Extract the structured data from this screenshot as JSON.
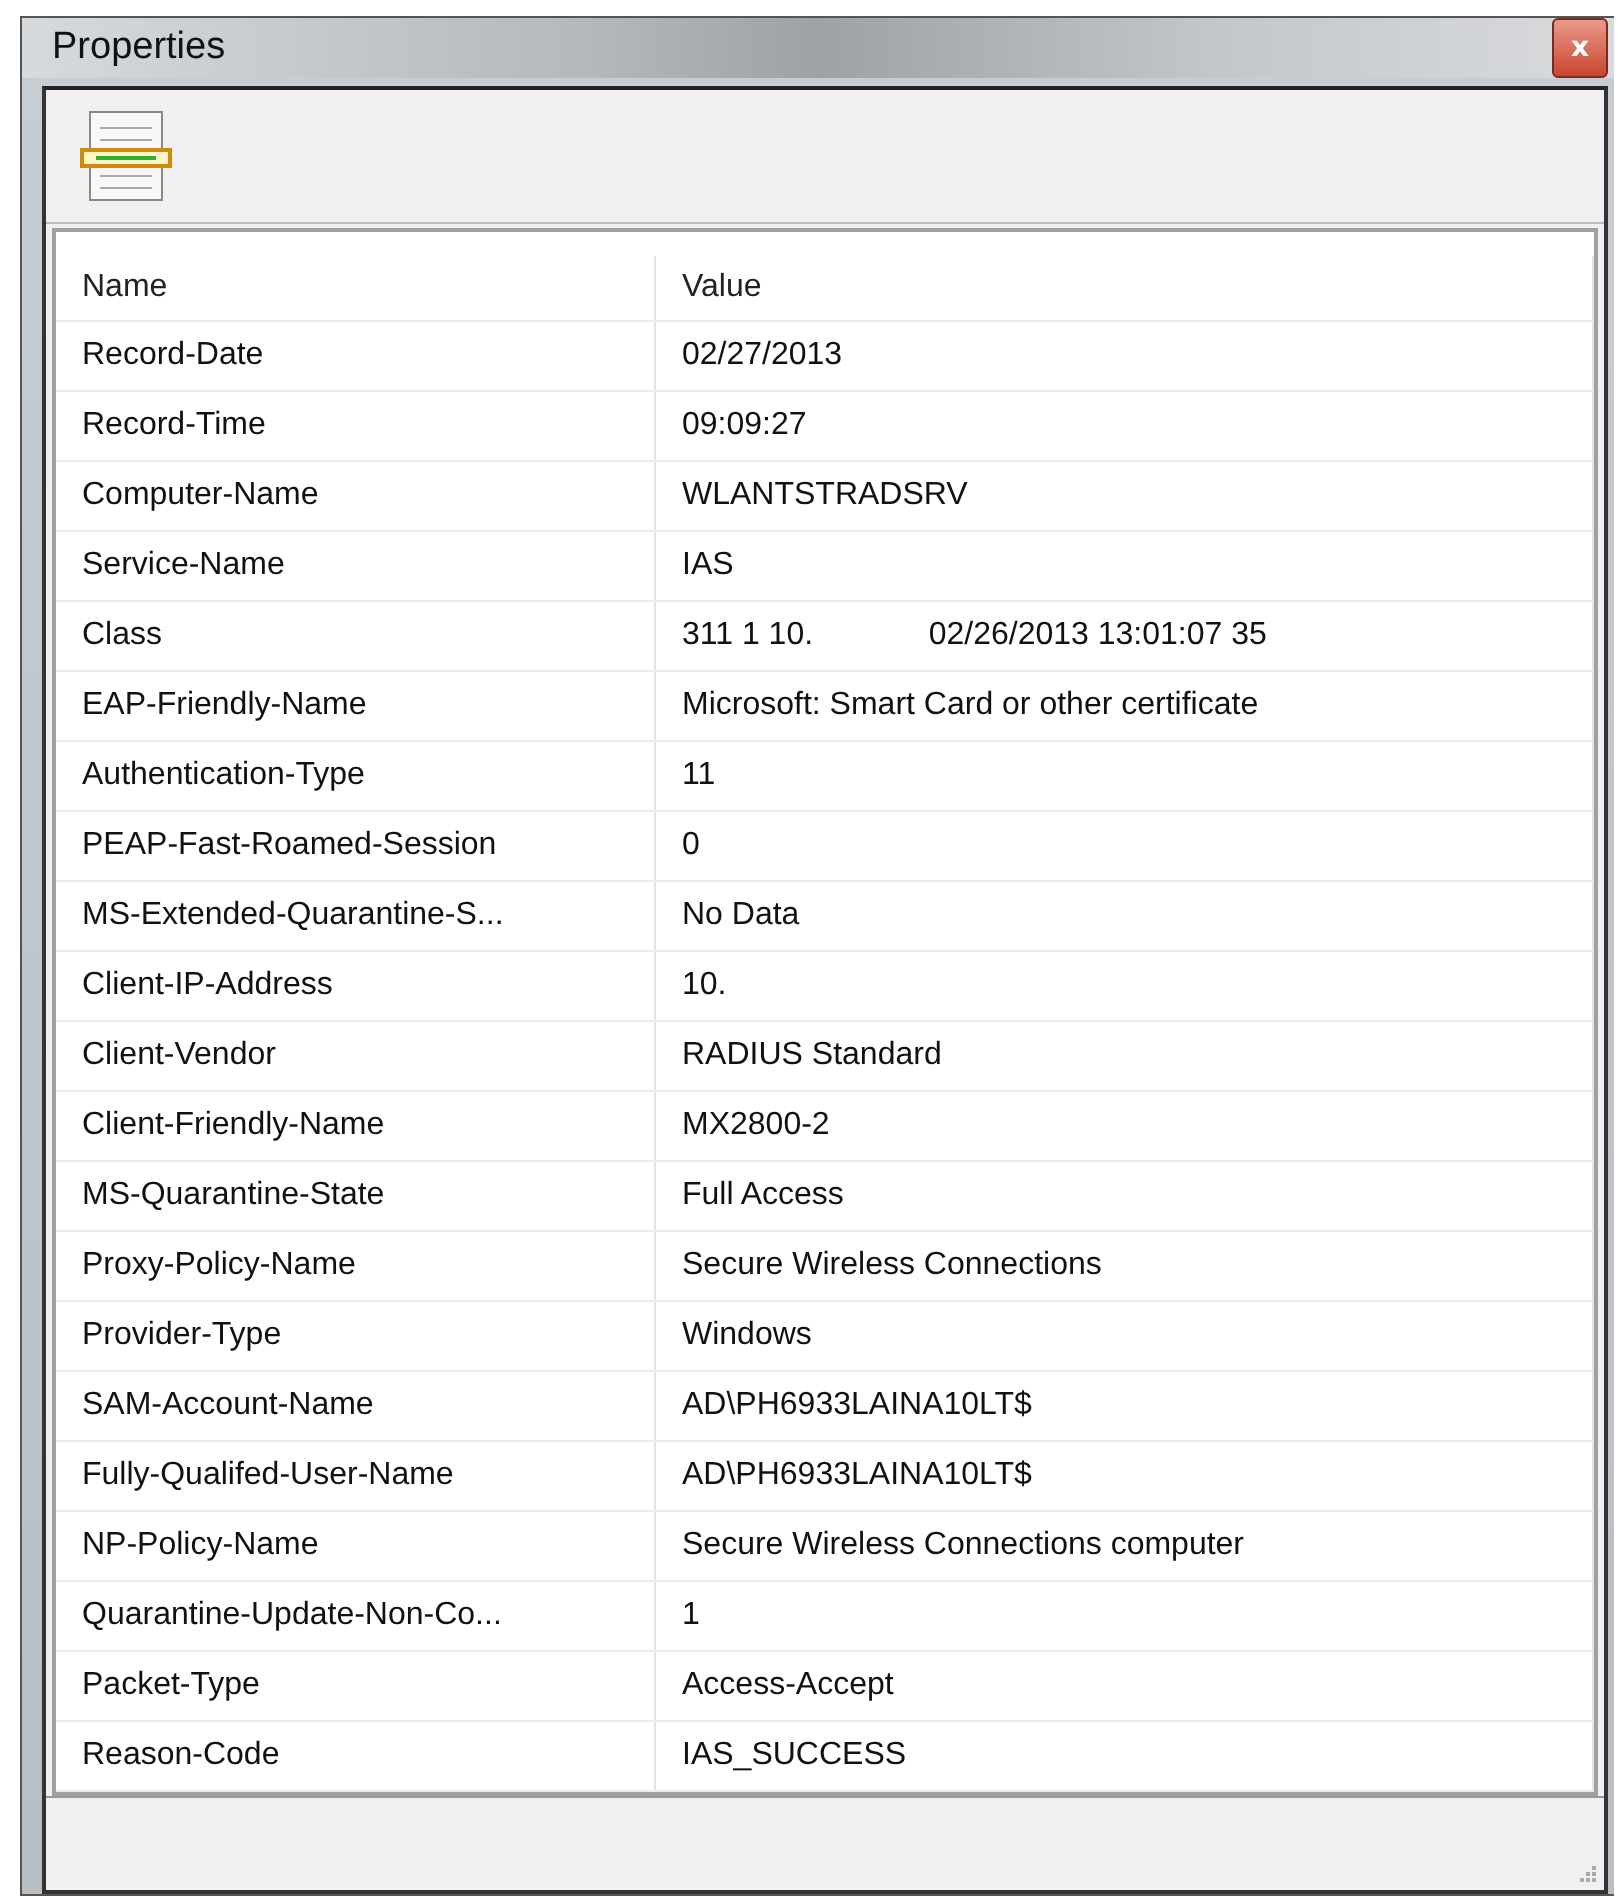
{
  "window": {
    "title": "Properties",
    "close": "x"
  },
  "table": {
    "columns": [
      "Name",
      "Value"
    ],
    "rows": [
      [
        "Record-Date",
        "02/27/2013"
      ],
      [
        "Record-Time",
        "09:09:27"
      ],
      [
        "Computer-Name",
        "WLANTSTRADSRV"
      ],
      [
        "Service-Name",
        "IAS"
      ],
      [
        "Class",
        "311 1 10.             02/26/2013 13:01:07 35"
      ],
      [
        "EAP-Friendly-Name",
        "Microsoft: Smart Card or other certificate"
      ],
      [
        "Authentication-Type",
        "11"
      ],
      [
        "PEAP-Fast-Roamed-Session",
        "0"
      ],
      [
        "MS-Extended-Quarantine-S...",
        "No Data"
      ],
      [
        "Client-IP-Address",
        "10."
      ],
      [
        "Client-Vendor",
        "RADIUS Standard"
      ],
      [
        "Client-Friendly-Name",
        "MX2800-2"
      ],
      [
        "MS-Quarantine-State",
        "Full Access"
      ],
      [
        "Proxy-Policy-Name",
        "Secure Wireless Connections"
      ],
      [
        "Provider-Type",
        "Windows"
      ],
      [
        "SAM-Account-Name",
        "AD\\PH6933LAINA10LT$"
      ],
      [
        "Fully-Qualifed-User-Name",
        "AD\\PH6933LAINA10LT$"
      ],
      [
        "NP-Policy-Name",
        "Secure Wireless Connections computer"
      ],
      [
        "Quarantine-Update-Non-Co...",
        "1"
      ],
      [
        "Packet-Type",
        "Access-Accept"
      ],
      [
        "Reason-Code",
        "IAS_SUCCESS"
      ]
    ]
  }
}
